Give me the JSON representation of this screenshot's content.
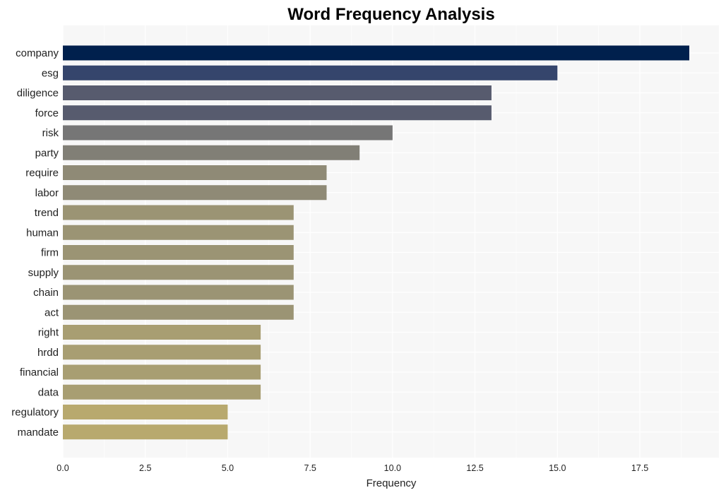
{
  "chart_data": {
    "type": "bar",
    "orientation": "horizontal",
    "title": "Word Frequency Analysis",
    "xlabel": "Frequency",
    "ylabel": "",
    "xlim": [
      0,
      19.9
    ],
    "xticks": [
      0,
      2.5,
      5,
      7.5,
      10,
      12.5,
      15,
      17.5
    ],
    "xtick_labels": [
      "0.0",
      "2.5",
      "5.0",
      "7.5",
      "10.0",
      "12.5",
      "15.0",
      "17.5"
    ],
    "grid": true,
    "categories": [
      "company",
      "esg",
      "diligence",
      "force",
      "risk",
      "party",
      "require",
      "labor",
      "trend",
      "human",
      "firm",
      "supply",
      "chain",
      "act",
      "right",
      "hrdd",
      "financial",
      "data",
      "regulatory",
      "mandate"
    ],
    "values": [
      19,
      15,
      13,
      13,
      10,
      9,
      8,
      8,
      7,
      7,
      7,
      7,
      7,
      7,
      6,
      6,
      6,
      6,
      5,
      5
    ],
    "colors": [
      "#00204d",
      "#35456c",
      "#575b6e",
      "#575b6e",
      "#767676",
      "#817f76",
      "#8f8a76",
      "#8f8a76",
      "#9b9474",
      "#9b9474",
      "#9b9474",
      "#9b9474",
      "#9b9474",
      "#9b9474",
      "#a89e72",
      "#a89e72",
      "#a89e72",
      "#a89e72",
      "#b8a96e",
      "#b8a96e"
    ],
    "background_color": "#f7f7f7",
    "grid_color": "#ffffff"
  }
}
